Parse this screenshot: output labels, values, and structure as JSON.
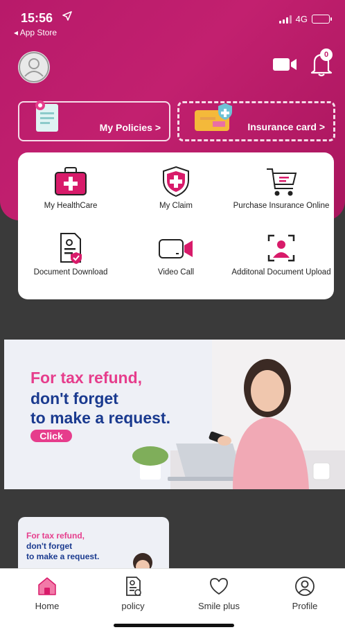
{
  "status_bar": {
    "time": "15:56",
    "back_app": "◂ App Store",
    "network": "4G"
  },
  "header": {
    "notification_count": "0"
  },
  "hero_cards": [
    {
      "label": "My Policies >"
    },
    {
      "label": "Insurance card >"
    }
  ],
  "menu": {
    "items": [
      {
        "label": "My HealthCare"
      },
      {
        "label": "My Claim"
      },
      {
        "label": "Purchase Insurance Online"
      },
      {
        "label": "Document Download"
      },
      {
        "label": "Video Call"
      },
      {
        "label": "Additonal Document Upload"
      }
    ]
  },
  "banner": {
    "line1": "For tax refund,",
    "line2": "don't forget",
    "line3": "to make a request.",
    "button": "Click"
  },
  "small_banner": {
    "line1": "For tax refund,",
    "line2": "don't forget",
    "line3": "to make a request."
  },
  "tabs": [
    {
      "label": "Home"
    },
    {
      "label": "policy"
    },
    {
      "label": "Smile plus"
    },
    {
      "label": "Profile"
    }
  ],
  "colors": {
    "brand": "#c2206f",
    "accent_pink": "#e63d8c",
    "navy": "#1a3a8f"
  }
}
